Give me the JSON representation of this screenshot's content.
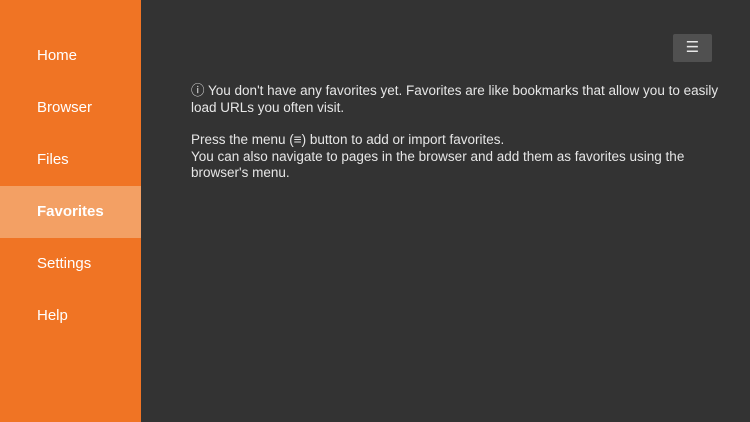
{
  "sidebar": {
    "items": [
      {
        "label": "Home"
      },
      {
        "label": "Browser"
      },
      {
        "label": "Files"
      },
      {
        "label": "Favorites"
      },
      {
        "label": "Settings"
      },
      {
        "label": "Help"
      }
    ],
    "selected": "Favorites"
  },
  "toolbar": {
    "menu_icon": "☰"
  },
  "main": {
    "empty_message_line1": "ⓘ You don't have any favorites yet. Favorites are like bookmarks that allow you to easily load URLs you often visit.",
    "instruction_line1": "Press the menu (≡) button to add or import favorites.",
    "instruction_line2": "You can also navigate to pages in the browser and add them as favorites using the browser's menu."
  },
  "colors": {
    "sidebar_bg": "#f07424",
    "sidebar_selected_bg": "#f3a064",
    "main_bg": "#333333",
    "menu_button_bg": "#505050"
  }
}
